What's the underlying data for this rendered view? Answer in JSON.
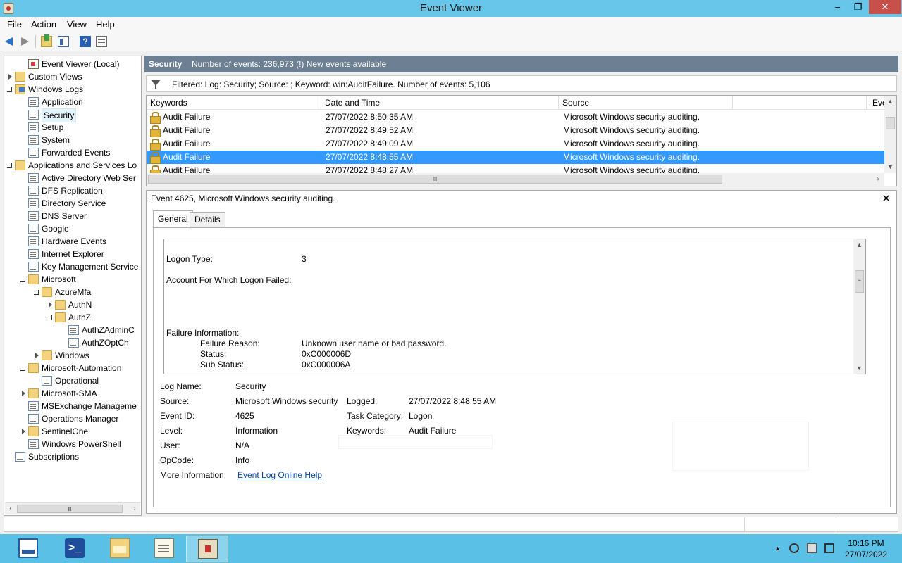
{
  "window": {
    "title": "Event Viewer",
    "controls": {
      "minimize": "–",
      "maximize": "❐",
      "close": "✕"
    }
  },
  "menu": [
    "File",
    "Action",
    "View",
    "Help"
  ],
  "toolbar": {
    "help_glyph": "?"
  },
  "tree": {
    "items": [
      {
        "label": "Event Viewer (Local)",
        "icon": "root-icon",
        "expander": "none"
      },
      {
        "label": "Custom Views",
        "icon": "folder-icon",
        "expander": "collapsed"
      },
      {
        "label": "Windows Logs",
        "icon": "windows-logs-icon",
        "expander": "expanded"
      },
      {
        "label": "Application",
        "icon": "log-icon",
        "expander": "none"
      },
      {
        "label": "Security",
        "icon": "log-icon",
        "expander": "none",
        "selected": true
      },
      {
        "label": "Setup",
        "icon": "log-icon",
        "expander": "none"
      },
      {
        "label": "System",
        "icon": "log-icon",
        "expander": "none"
      },
      {
        "label": "Forwarded Events",
        "icon": "log-icon",
        "expander": "none"
      },
      {
        "label": "Applications and Services Lo",
        "icon": "folder-icon",
        "expander": "expanded"
      },
      {
        "label": "Active Directory Web Ser",
        "icon": "log-icon",
        "expander": "none"
      },
      {
        "label": "DFS Replication",
        "icon": "log-icon",
        "expander": "none"
      },
      {
        "label": "Directory Service",
        "icon": "log-icon",
        "expander": "none"
      },
      {
        "label": "DNS Server",
        "icon": "log-icon",
        "expander": "none"
      },
      {
        "label": "Google",
        "icon": "log-icon",
        "expander": "none"
      },
      {
        "label": "Hardware Events",
        "icon": "log-icon",
        "expander": "none"
      },
      {
        "label": "Internet Explorer",
        "icon": "log-icon",
        "expander": "none"
      },
      {
        "label": "Key Management Service",
        "icon": "log-icon",
        "expander": "none"
      },
      {
        "label": "Microsoft",
        "icon": "folder-icon",
        "expander": "expanded"
      },
      {
        "label": "AzureMfa",
        "icon": "folder-icon",
        "expander": "expanded"
      },
      {
        "label": "AuthN",
        "icon": "folder-icon",
        "expander": "collapsed"
      },
      {
        "label": "AuthZ",
        "icon": "folder-icon",
        "expander": "expanded"
      },
      {
        "label": "AuthZAdminC",
        "icon": "log-icon",
        "expander": "none"
      },
      {
        "label": "AuthZOptCh",
        "icon": "log-icon",
        "expander": "none"
      },
      {
        "label": "Windows",
        "icon": "folder-icon",
        "expander": "collapsed"
      },
      {
        "label": "Microsoft-Automation",
        "icon": "folder-icon",
        "expander": "expanded"
      },
      {
        "label": "Operational",
        "icon": "log-icon",
        "expander": "none"
      },
      {
        "label": "Microsoft-SMA",
        "icon": "folder-icon",
        "expander": "collapsed"
      },
      {
        "label": "MSExchange Manageme",
        "icon": "log-icon",
        "expander": "none"
      },
      {
        "label": "Operations Manager",
        "icon": "log-icon",
        "expander": "none"
      },
      {
        "label": "SentinelOne",
        "icon": "folder-icon",
        "expander": "collapsed"
      },
      {
        "label": "Windows PowerShell",
        "icon": "log-icon",
        "expander": "none"
      },
      {
        "label": "Subscriptions",
        "icon": "log-icon",
        "expander": "none"
      }
    ]
  },
  "header": {
    "title": "Security",
    "info": "Number of events: 236,973 (!) New events available"
  },
  "filter": {
    "text": "Filtered: Log: Security; Source: ; Keyword: win:AuditFailure. Number of events: 5,106"
  },
  "grid": {
    "columns": [
      "Keywords",
      "Date and Time",
      "Source",
      "",
      "Eve"
    ],
    "rows": [
      {
        "keywords": "Audit Failure",
        "datetime": "27/07/2022 8:50:35 AM",
        "source": "Microsoft Windows security auditing."
      },
      {
        "keywords": "Audit Failure",
        "datetime": "27/07/2022 8:49:52 AM",
        "source": "Microsoft Windows security auditing."
      },
      {
        "keywords": "Audit Failure",
        "datetime": "27/07/2022 8:49:09 AM",
        "source": "Microsoft Windows security auditing."
      },
      {
        "keywords": "Audit Failure",
        "datetime": "27/07/2022 8:48:55 AM",
        "source": "Microsoft Windows security auditing.",
        "selected": true
      },
      {
        "keywords": "Audit Failure",
        "datetime": "27/07/2022 8:48:27 AM",
        "source": "Microsoft Windows security auditing."
      }
    ]
  },
  "scroll_glyphs": {
    "up": "▲",
    "down": "▼",
    "left": "‹",
    "right": "›",
    "grip_h": "Ⅲ",
    "grip_v": "≡"
  },
  "detail": {
    "title": "Event 4625, Microsoft Windows security auditing.",
    "close": "✕",
    "tabs": [
      "General",
      "Details"
    ],
    "description": {
      "logon_type_label": "Logon Type:",
      "logon_type_value": "3",
      "account_label": "Account For Which Logon Failed:",
      "failure_info_label": "Failure Information:",
      "failure_reason_label": "Failure Reason:",
      "failure_reason_value": "Unknown user name or bad password.",
      "status_label": "Status:",
      "status_value": "0xC000006D",
      "sub_status_label": "Sub Status:",
      "sub_status_value": "0xC000006A"
    },
    "props": {
      "log_name_label": "Log Name:",
      "log_name": "Security",
      "source_label": "Source:",
      "source": "Microsoft Windows security",
      "logged_label": "Logged:",
      "logged": "27/07/2022 8:48:55 AM",
      "event_id_label": "Event ID:",
      "event_id": "4625",
      "task_category_label": "Task Category:",
      "task_category": "Logon",
      "level_label": "Level:",
      "level": "Information",
      "keywords_label": "Keywords:",
      "keywords": "Audit Failure",
      "user_label": "User:",
      "user": "N/A",
      "opcode_label": "OpCode:",
      "opcode": "Info",
      "more_info_label": "More Information:",
      "more_info_link": "Event Log Online Help"
    }
  },
  "taskbar": {
    "ps_glyph": ">_",
    "tray_arrow": "▲",
    "clock_time": "10:16 PM",
    "clock_date": "27/07/2022"
  }
}
